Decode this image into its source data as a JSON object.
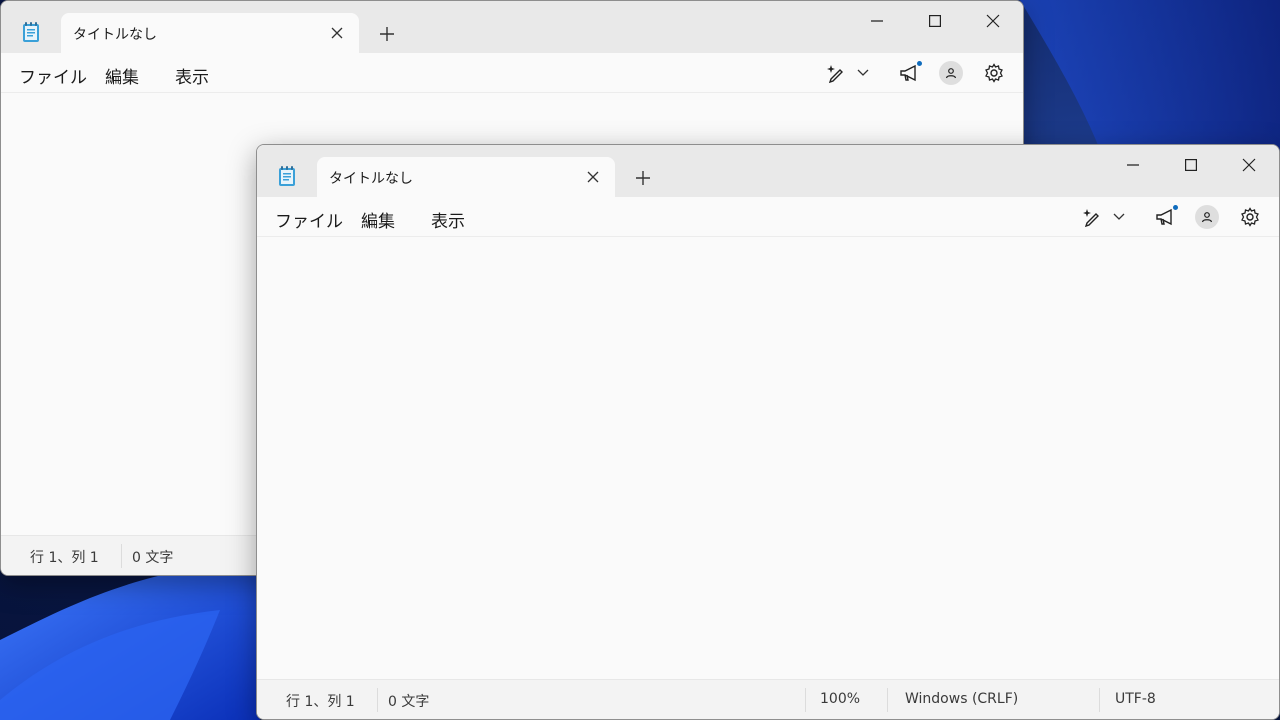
{
  "windows": [
    {
      "role": "back",
      "tab": {
        "title": "タイトルなし"
      },
      "menu": {
        "file": "ファイル",
        "edit": "編集",
        "view": "表示"
      },
      "status": {
        "position": "行 1、列 1",
        "chars": "0 文字"
      }
    },
    {
      "role": "front",
      "tab": {
        "title": "タイトルなし"
      },
      "menu": {
        "file": "ファイル",
        "edit": "編集",
        "view": "表示"
      },
      "status": {
        "position": "行 1、列 1",
        "chars": "0 文字",
        "zoom": "100%",
        "line_ending": "Windows (CRLF)",
        "encoding": "UTF-8"
      }
    }
  ],
  "icons": {
    "app": "notepad-icon",
    "close": "close-icon",
    "new_tab": "plus-icon",
    "minimize": "minimize-icon",
    "maximize": "maximize-icon",
    "copilot": "copilot-pen-icon",
    "announce": "megaphone-icon",
    "account": "person-icon",
    "settings": "gear-icon"
  },
  "colors": {
    "accent": "#0f6cbd",
    "titlebar": "#e9e9e9",
    "window_bg": "#fafafa",
    "wallpaper": "#0a1a4d"
  }
}
